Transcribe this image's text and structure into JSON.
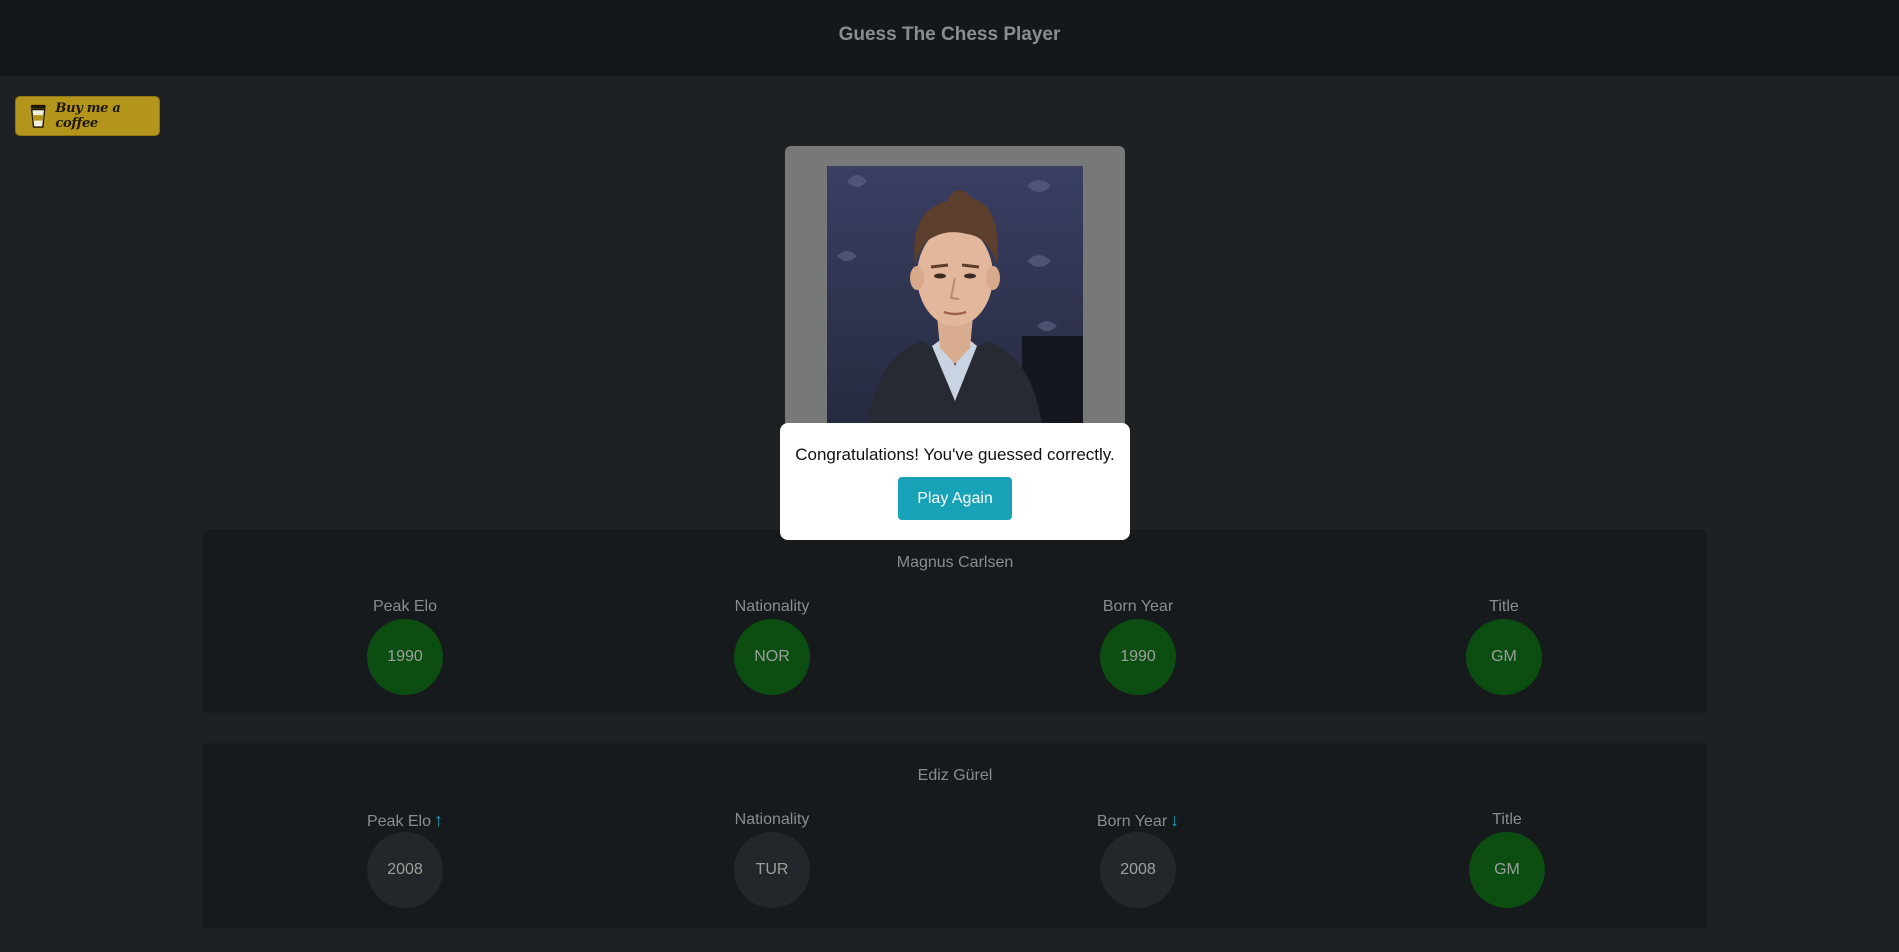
{
  "app": {
    "title": "Guess The Chess Player"
  },
  "coffee": {
    "label": "Buy me a coffee"
  },
  "modal": {
    "message": "Congratulations! You've guessed correctly.",
    "button_label": "Play Again"
  },
  "guesses": [
    {
      "name": "Magnus Carlsen",
      "attributes": [
        {
          "label": "Peak Elo",
          "value": "1990",
          "status": "correct",
          "hint": ""
        },
        {
          "label": "Nationality",
          "value": "NOR",
          "status": "correct",
          "hint": ""
        },
        {
          "label": "Born Year",
          "value": "1990",
          "status": "correct",
          "hint": ""
        },
        {
          "label": "Title",
          "value": "GM",
          "status": "correct",
          "hint": ""
        }
      ]
    },
    {
      "name": "Ediz Gürel",
      "attributes": [
        {
          "label": "Peak Elo",
          "value": "2008",
          "status": "wrong",
          "hint": "up"
        },
        {
          "label": "Nationality",
          "value": "TUR",
          "status": "wrong",
          "hint": ""
        },
        {
          "label": "Born Year",
          "value": "2008",
          "status": "wrong",
          "hint": "down"
        },
        {
          "label": "Title",
          "value": "GM",
          "status": "correct",
          "hint": ""
        }
      ]
    }
  ],
  "colors": {
    "correct": "#0c4d12",
    "wrong": "#23272b",
    "accent": "#17a2b8",
    "coffee": "#b4951b"
  }
}
